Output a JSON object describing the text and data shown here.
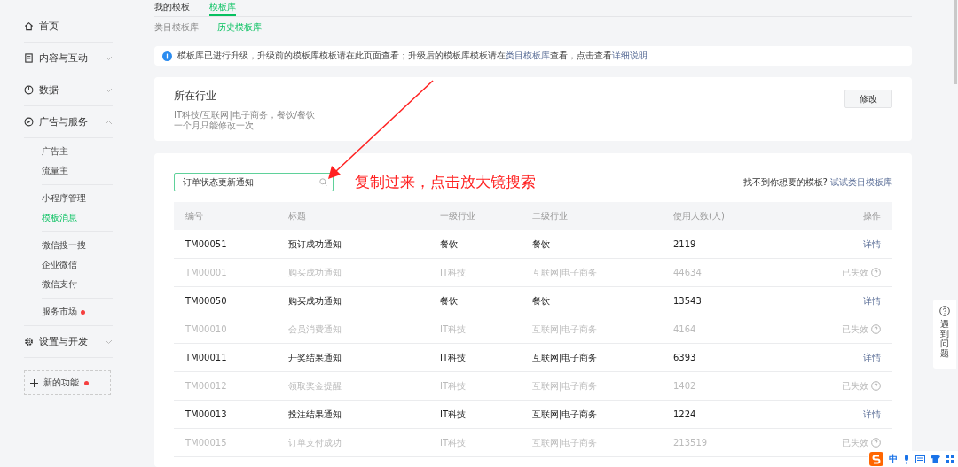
{
  "sidebar": {
    "items": [
      {
        "label": "首页"
      },
      {
        "label": "内容与互动",
        "expanded": false
      },
      {
        "label": "数据",
        "expanded": false
      },
      {
        "label": "广告与服务",
        "expanded": true,
        "children": [
          {
            "items": [
              {
                "label": "广告主",
                "selected": false,
                "dot": false
              },
              {
                "label": "流量主",
                "selected": false,
                "dot": false
              }
            ]
          },
          {
            "items": [
              {
                "label": "小程序管理",
                "selected": false,
                "dot": false
              },
              {
                "label": "模板消息",
                "selected": true,
                "dot": false
              }
            ]
          },
          {
            "items": [
              {
                "label": "微信搜一搜",
                "selected": false,
                "dot": false
              },
              {
                "label": "企业微信",
                "selected": false,
                "dot": false
              },
              {
                "label": "微信支付",
                "selected": false,
                "dot": false
              }
            ]
          },
          {
            "items": [
              {
                "label": "服务市场",
                "selected": false,
                "dot": true
              }
            ]
          }
        ]
      },
      {
        "label": "设置与开发",
        "expanded": false
      }
    ],
    "new_feature": {
      "label": "新的功能",
      "dot": true
    }
  },
  "tabs": [
    {
      "label": "我的模板",
      "selected": false
    },
    {
      "label": "模板库",
      "selected": true
    }
  ],
  "subtabs": [
    {
      "label": "类目模板库",
      "selected": false
    },
    {
      "label": "历史模板库",
      "selected": true
    }
  ],
  "notice": {
    "parts": [
      {
        "text": "模板库已进行升级，升级前的模板库模板请在此页面查看；升级后的模板库模板请在",
        "link": false
      },
      {
        "text": "类目模板库",
        "link": true
      },
      {
        "text": "查看，点击查看",
        "link": false
      },
      {
        "text": "详细说明",
        "link": true
      }
    ]
  },
  "industry": {
    "title": "所在行业",
    "value": "IT科技/互联网|电子商务，餐饮/餐饮",
    "note": "一个月只能修改一次",
    "button": "修改"
  },
  "search": {
    "value": "订单状态更新通知"
  },
  "hint": {
    "text": "找不到你想要的模板?",
    "link": "试试类目模板库"
  },
  "annotation": {
    "text": "复制过来，点击放大镜搜索"
  },
  "table": {
    "columns": [
      "编号",
      "标题",
      "一级行业",
      "二级行业",
      "使用人数(人)",
      "操作"
    ],
    "rows": [
      {
        "cells": [
          "TM00051",
          "预订成功通知",
          "餐饮",
          "餐饮",
          "2119"
        ],
        "action": "详情",
        "expired": false
      },
      {
        "cells": [
          "TM00001",
          "购买成功通知",
          "IT科技",
          "互联网|电子商务",
          "44634"
        ],
        "action": "已失效",
        "expired": true
      },
      {
        "cells": [
          "TM00050",
          "购买成功通知",
          "餐饮",
          "餐饮",
          "13543"
        ],
        "action": "详情",
        "expired": false
      },
      {
        "cells": [
          "TM00010",
          "会员消费通知",
          "IT科技",
          "互联网|电子商务",
          "4164"
        ],
        "action": "已失效",
        "expired": true
      },
      {
        "cells": [
          "TM00011",
          "开奖结果通知",
          "IT科技",
          "互联网|电子商务",
          "6393"
        ],
        "action": "详情",
        "expired": false
      },
      {
        "cells": [
          "TM00012",
          "领取奖金提醒",
          "IT科技",
          "互联网|电子商务",
          "1402"
        ],
        "action": "已失效",
        "expired": true
      },
      {
        "cells": [
          "TM00013",
          "投注结果通知",
          "IT科技",
          "互联网|电子商务",
          "1224"
        ],
        "action": "详情",
        "expired": false
      },
      {
        "cells": [
          "TM00015",
          "订单支付成功",
          "IT科技",
          "互联网|电子商务",
          "213519"
        ],
        "action": "已失效",
        "expired": true
      }
    ]
  },
  "help_tab": {
    "label": "遇到问题"
  },
  "ime": {
    "label": "中"
  }
}
